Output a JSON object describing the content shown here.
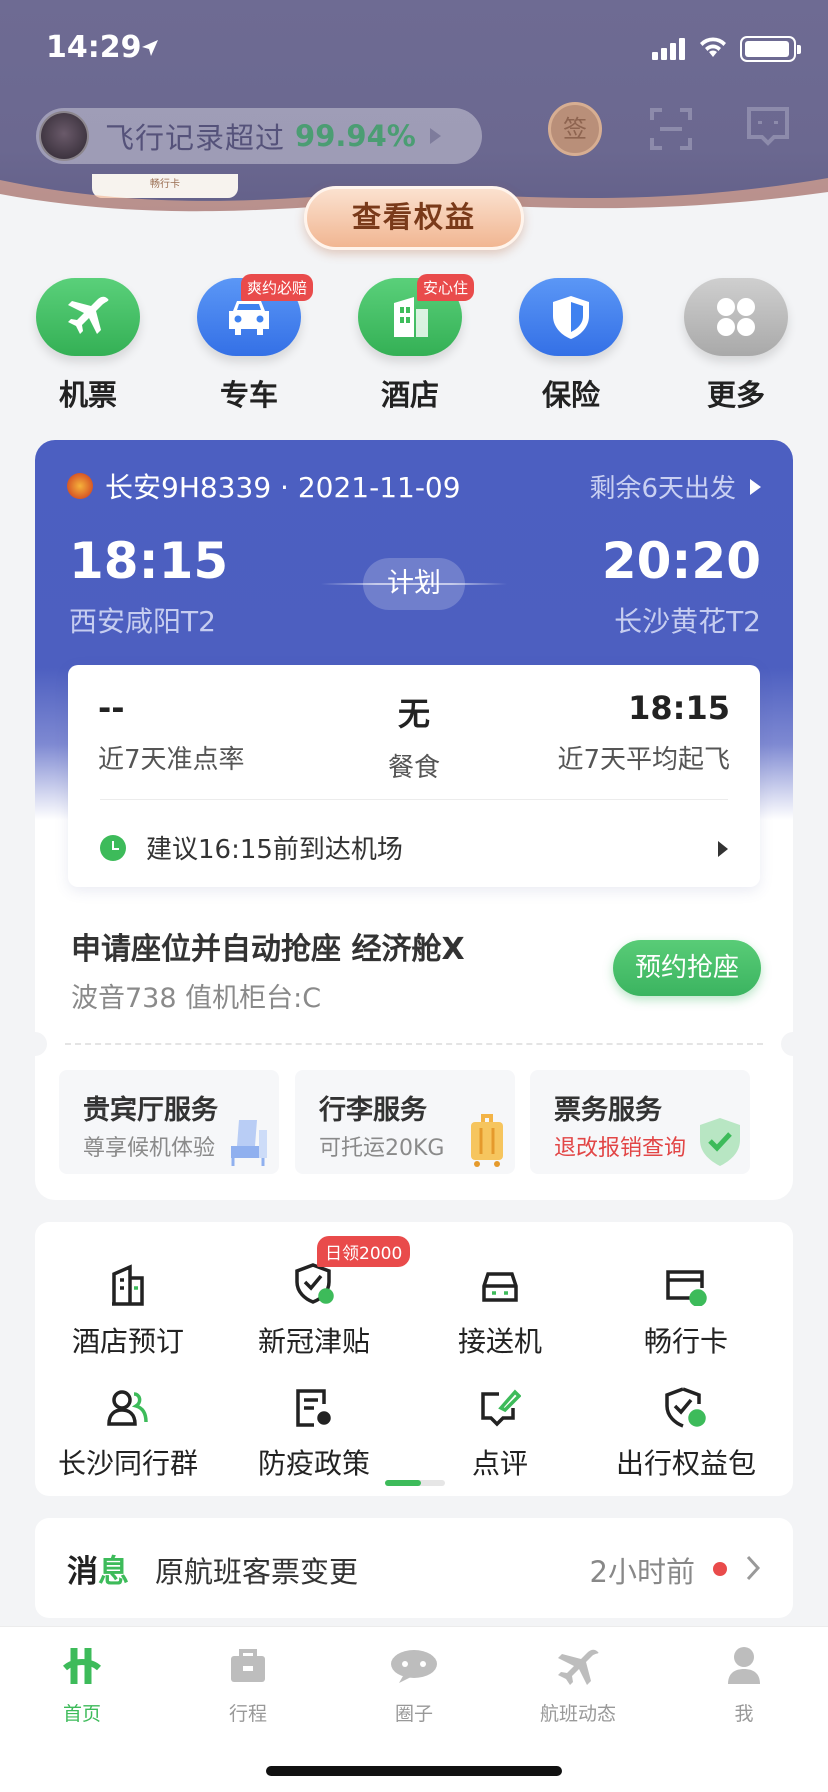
{
  "status_bar": {
    "time": "14:29"
  },
  "header": {
    "record_text": "飞行记录超过",
    "record_percent": "99.94%",
    "sign_label": "签",
    "card_text": "畅行卡",
    "rights_button": "查看权益"
  },
  "quick_services": [
    {
      "label": "机票",
      "badge": "",
      "color": "#3fbd5c",
      "icon": "airplane-icon"
    },
    {
      "label": "专车",
      "badge": "爽约必赔",
      "color": "#3f82f0",
      "icon": "car-icon"
    },
    {
      "label": "酒店",
      "badge": "安心住",
      "color": "#3fbd5c",
      "icon": "hotel-icon"
    },
    {
      "label": "保险",
      "badge": "",
      "color": "#3f82f0",
      "icon": "shield-icon"
    },
    {
      "label": "更多",
      "badge": "",
      "color": "#b9b9b9",
      "icon": "more-icon"
    }
  ],
  "flight": {
    "airline_flight": "长安9H8339 · 2021-11-09",
    "remaining": "剩余6天出发",
    "dep_time": "18:15",
    "dep_airport": "西安咸阳T2",
    "arr_time": "20:20",
    "arr_airport": "长沙黄花T2",
    "status": "计划",
    "stats": [
      {
        "value": "--",
        "label": "近7天准点率"
      },
      {
        "value": "无",
        "label": "餐食"
      },
      {
        "value": "18:15",
        "label": "近7天平均起飞"
      }
    ],
    "tip": "建议16:15前到达机场",
    "seat_title": "申请座位并自动抢座 经济舱X",
    "seat_sub": "波音738 值机柜台:C",
    "seat_button": "预约抢座",
    "services": [
      {
        "title": "贵宾厅服务",
        "sub": "尊享候机体验",
        "icon": "lounge-chair-icon"
      },
      {
        "title": "行李服务",
        "sub": "可托运20KG",
        "icon": "luggage-icon"
      },
      {
        "title": "票务服务",
        "sub": "退改报销查询",
        "icon": "ticket-shield-icon"
      }
    ]
  },
  "grid": [
    {
      "label": "酒店预订",
      "badge": ""
    },
    {
      "label": "新冠津贴",
      "badge": "日领2000"
    },
    {
      "label": "接送机",
      "badge": ""
    },
    {
      "label": "畅行卡",
      "badge": ""
    },
    {
      "label": "长沙同行群",
      "badge": ""
    },
    {
      "label": "防疫政策",
      "badge": ""
    },
    {
      "label": "点评",
      "badge": ""
    },
    {
      "label": "出行权益包",
      "badge": ""
    }
  ],
  "message": {
    "tag_a": "消",
    "tag_b": "息",
    "text": "原航班客票变更",
    "time": "2小时前"
  },
  "tabs": [
    {
      "label": "首页",
      "active": true
    },
    {
      "label": "行程",
      "active": false
    },
    {
      "label": "圈子",
      "active": false
    },
    {
      "label": "航班动态",
      "active": false
    },
    {
      "label": "我",
      "active": false
    }
  ],
  "colors": {
    "brand_green": "#3dbb5a",
    "card_blue": "#4c5fc1",
    "badge_red": "#e94b4b"
  }
}
